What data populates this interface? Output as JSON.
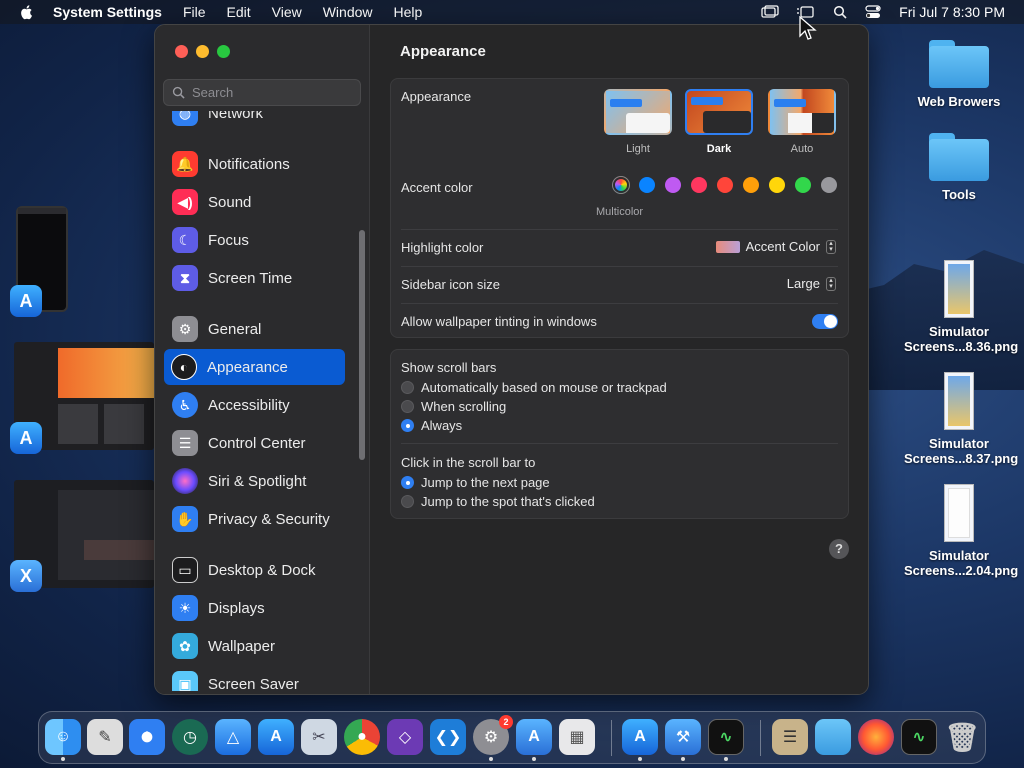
{
  "menubar": {
    "app_name": "System Settings",
    "menus": [
      "File",
      "Edit",
      "View",
      "Window",
      "Help"
    ],
    "clock": "Fri Jul 7  8:30 PM"
  },
  "desktop": {
    "items": [
      {
        "label": "Web Browers",
        "icon": "folder-icon"
      },
      {
        "label": "Tools",
        "icon": "folder-icon"
      },
      {
        "label": "Simulator Screens...8.36.png",
        "line1": "Simulator",
        "line2": "Screens...8.36.png",
        "icon": "screenshot-file-icon"
      },
      {
        "label": "Simulator Screens...8.37.png",
        "line1": "Simulator",
        "line2": "Screens...8.37.png",
        "icon": "screenshot-file-icon"
      },
      {
        "label": "Simulator Screens...2.04.png",
        "line1": "Simulator",
        "line2": "Screens...2.04.png",
        "icon": "screenshot-file-icon"
      }
    ]
  },
  "sidebar": {
    "search_placeholder": "Search",
    "items": [
      {
        "label": "Network",
        "color": "#2f7ff2"
      },
      {
        "label": "Notifications",
        "color": "#ff3b30"
      },
      {
        "label": "Sound",
        "color": "#ff2d55"
      },
      {
        "label": "Focus",
        "color": "#5e5ce6"
      },
      {
        "label": "Screen Time",
        "color": "#5e5ce6"
      },
      {
        "label": "General",
        "color": "#8e8e93"
      },
      {
        "label": "Appearance",
        "color": "#1c1c1e"
      },
      {
        "label": "Accessibility",
        "color": "#2f7ff2"
      },
      {
        "label": "Control Center",
        "color": "#8e8e93"
      },
      {
        "label": "Siri & Spotlight",
        "color": "#af52de"
      },
      {
        "label": "Privacy & Security",
        "color": "#2f7ff2"
      },
      {
        "label": "Desktop & Dock",
        "color": "#1c1c1e"
      },
      {
        "label": "Displays",
        "color": "#2f7ff2"
      },
      {
        "label": "Wallpaper",
        "color": "#34aadc"
      },
      {
        "label": "Screen Saver",
        "color": "#5ac8fa"
      }
    ],
    "selected": "Appearance"
  },
  "content": {
    "title": "Appearance",
    "appearance_label": "Appearance",
    "appearance_options": [
      {
        "label": "Light",
        "selected": false
      },
      {
        "label": "Dark",
        "selected": true
      },
      {
        "label": "Auto",
        "selected": false
      }
    ],
    "accent_label": "Accent color",
    "accent_colors": [
      "multicolor",
      "#0a84ff",
      "#bf5af2",
      "#ff375f",
      "#ff453a",
      "#ff9f0a",
      "#ffd60a",
      "#32d74b",
      "#98989d"
    ],
    "accent_selected_label": "Multicolor",
    "highlight_label": "Highlight color",
    "highlight_value": "Accent Color",
    "icon_size_label": "Sidebar icon size",
    "icon_size_value": "Large",
    "tinting_label": "Allow wallpaper tinting in windows",
    "tinting_on": true,
    "scroll_bars_label": "Show scroll bars",
    "scroll_bar_options": [
      {
        "label": "Automatically based on mouse or trackpad",
        "selected": false
      },
      {
        "label": "When scrolling",
        "selected": false
      },
      {
        "label": "Always",
        "selected": true
      }
    ],
    "click_label": "Click in the scroll bar to",
    "click_options": [
      {
        "label": "Jump to the next page",
        "selected": true
      },
      {
        "label": "Jump to the spot that's clicked",
        "selected": false
      }
    ],
    "help": "?"
  },
  "dock": {
    "apps": [
      "Finder",
      "Script Editor",
      "Safari",
      "Time Machine",
      "Instruments",
      "App Store",
      "Preview",
      "Chrome",
      "Visual Studio",
      "VS Code",
      "System Settings",
      "Xcode Simulator",
      "Launchpad",
      "App Store",
      "Xcode",
      "Activity Monitor",
      "Archive",
      "Folder",
      "Firefox",
      "Activity Monitor",
      "Trash"
    ],
    "settings_badge": "2"
  }
}
